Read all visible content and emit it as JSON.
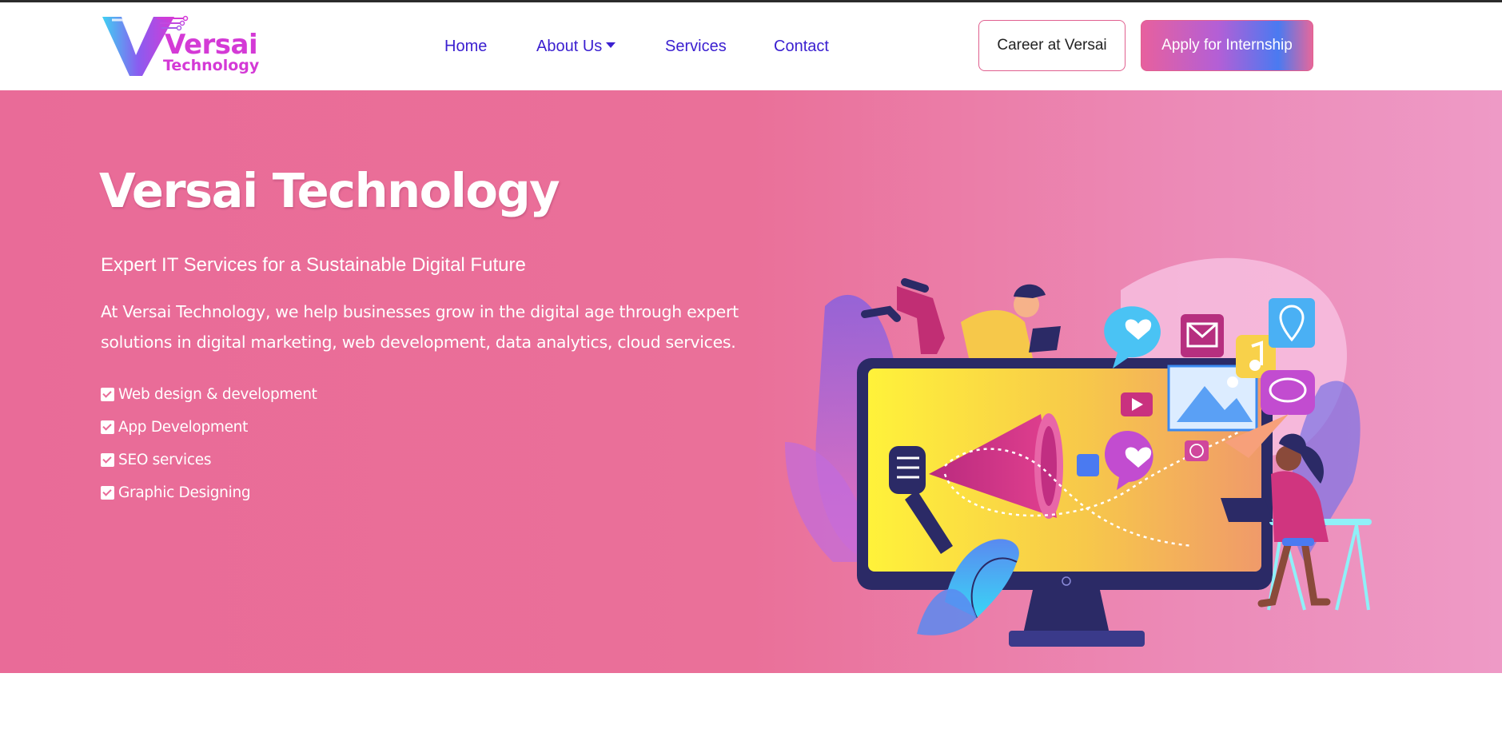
{
  "brand": {
    "name_line1": "Versai",
    "name_line2": "Technology",
    "colors": {
      "magenta": "#d43ad6",
      "cyan": "#3fd1f2",
      "nav": "#3a1fd0",
      "hero_bg": "#e96b98",
      "accent_border": "#e0608f"
    }
  },
  "nav": {
    "items": [
      {
        "label": "Home"
      },
      {
        "label": "About Us",
        "icon": "caret-down-icon"
      },
      {
        "label": "Services"
      },
      {
        "label": "Contact"
      }
    ]
  },
  "header_buttons": {
    "career_label": "Career at Versai",
    "apply_label": "Apply for Internship"
  },
  "hero": {
    "title": "Versai Technology",
    "subtitle": "Expert IT Services for a Sustainable Digital Future",
    "description": "At Versai Technology, we help businesses grow in the digital age through expert solutions in digital marketing, web development, data analytics, cloud services.",
    "features": [
      {
        "label": "Web design & development",
        "icon": "checkbox-checked-icon"
      },
      {
        "label": "App Development",
        "icon": "checkbox-checked-icon"
      },
      {
        "label": "SEO services",
        "icon": "checkbox-checked-icon"
      },
      {
        "label": "Graphic Designing",
        "icon": "checkbox-checked-icon"
      }
    ],
    "illustration": "digital-marketing-illustration"
  }
}
